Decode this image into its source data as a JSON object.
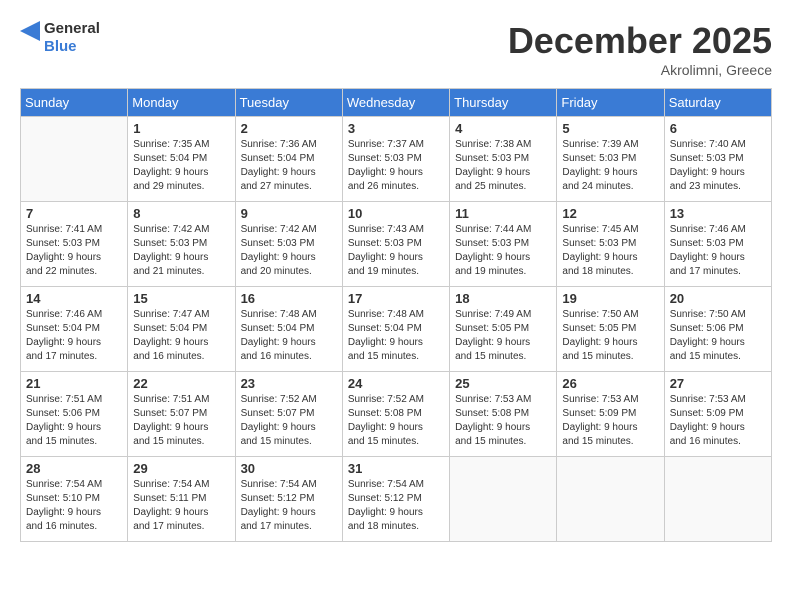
{
  "header": {
    "logo_general": "General",
    "logo_blue": "Blue",
    "month_title": "December 2025",
    "location": "Akrolimni, Greece"
  },
  "weekdays": [
    "Sunday",
    "Monday",
    "Tuesday",
    "Wednesday",
    "Thursday",
    "Friday",
    "Saturday"
  ],
  "weeks": [
    [
      {
        "day": "",
        "info": ""
      },
      {
        "day": "1",
        "info": "Sunrise: 7:35 AM\nSunset: 5:04 PM\nDaylight: 9 hours\nand 29 minutes."
      },
      {
        "day": "2",
        "info": "Sunrise: 7:36 AM\nSunset: 5:04 PM\nDaylight: 9 hours\nand 27 minutes."
      },
      {
        "day": "3",
        "info": "Sunrise: 7:37 AM\nSunset: 5:03 PM\nDaylight: 9 hours\nand 26 minutes."
      },
      {
        "day": "4",
        "info": "Sunrise: 7:38 AM\nSunset: 5:03 PM\nDaylight: 9 hours\nand 25 minutes."
      },
      {
        "day": "5",
        "info": "Sunrise: 7:39 AM\nSunset: 5:03 PM\nDaylight: 9 hours\nand 24 minutes."
      },
      {
        "day": "6",
        "info": "Sunrise: 7:40 AM\nSunset: 5:03 PM\nDaylight: 9 hours\nand 23 minutes."
      }
    ],
    [
      {
        "day": "7",
        "info": "Sunrise: 7:41 AM\nSunset: 5:03 PM\nDaylight: 9 hours\nand 22 minutes."
      },
      {
        "day": "8",
        "info": "Sunrise: 7:42 AM\nSunset: 5:03 PM\nDaylight: 9 hours\nand 21 minutes."
      },
      {
        "day": "9",
        "info": "Sunrise: 7:42 AM\nSunset: 5:03 PM\nDaylight: 9 hours\nand 20 minutes."
      },
      {
        "day": "10",
        "info": "Sunrise: 7:43 AM\nSunset: 5:03 PM\nDaylight: 9 hours\nand 19 minutes."
      },
      {
        "day": "11",
        "info": "Sunrise: 7:44 AM\nSunset: 5:03 PM\nDaylight: 9 hours\nand 19 minutes."
      },
      {
        "day": "12",
        "info": "Sunrise: 7:45 AM\nSunset: 5:03 PM\nDaylight: 9 hours\nand 18 minutes."
      },
      {
        "day": "13",
        "info": "Sunrise: 7:46 AM\nSunset: 5:03 PM\nDaylight: 9 hours\nand 17 minutes."
      }
    ],
    [
      {
        "day": "14",
        "info": "Sunrise: 7:46 AM\nSunset: 5:04 PM\nDaylight: 9 hours\nand 17 minutes."
      },
      {
        "day": "15",
        "info": "Sunrise: 7:47 AM\nSunset: 5:04 PM\nDaylight: 9 hours\nand 16 minutes."
      },
      {
        "day": "16",
        "info": "Sunrise: 7:48 AM\nSunset: 5:04 PM\nDaylight: 9 hours\nand 16 minutes."
      },
      {
        "day": "17",
        "info": "Sunrise: 7:48 AM\nSunset: 5:04 PM\nDaylight: 9 hours\nand 15 minutes."
      },
      {
        "day": "18",
        "info": "Sunrise: 7:49 AM\nSunset: 5:05 PM\nDaylight: 9 hours\nand 15 minutes."
      },
      {
        "day": "19",
        "info": "Sunrise: 7:50 AM\nSunset: 5:05 PM\nDaylight: 9 hours\nand 15 minutes."
      },
      {
        "day": "20",
        "info": "Sunrise: 7:50 AM\nSunset: 5:06 PM\nDaylight: 9 hours\nand 15 minutes."
      }
    ],
    [
      {
        "day": "21",
        "info": "Sunrise: 7:51 AM\nSunset: 5:06 PM\nDaylight: 9 hours\nand 15 minutes."
      },
      {
        "day": "22",
        "info": "Sunrise: 7:51 AM\nSunset: 5:07 PM\nDaylight: 9 hours\nand 15 minutes."
      },
      {
        "day": "23",
        "info": "Sunrise: 7:52 AM\nSunset: 5:07 PM\nDaylight: 9 hours\nand 15 minutes."
      },
      {
        "day": "24",
        "info": "Sunrise: 7:52 AM\nSunset: 5:08 PM\nDaylight: 9 hours\nand 15 minutes."
      },
      {
        "day": "25",
        "info": "Sunrise: 7:53 AM\nSunset: 5:08 PM\nDaylight: 9 hours\nand 15 minutes."
      },
      {
        "day": "26",
        "info": "Sunrise: 7:53 AM\nSunset: 5:09 PM\nDaylight: 9 hours\nand 15 minutes."
      },
      {
        "day": "27",
        "info": "Sunrise: 7:53 AM\nSunset: 5:09 PM\nDaylight: 9 hours\nand 16 minutes."
      }
    ],
    [
      {
        "day": "28",
        "info": "Sunrise: 7:54 AM\nSunset: 5:10 PM\nDaylight: 9 hours\nand 16 minutes."
      },
      {
        "day": "29",
        "info": "Sunrise: 7:54 AM\nSunset: 5:11 PM\nDaylight: 9 hours\nand 17 minutes."
      },
      {
        "day": "30",
        "info": "Sunrise: 7:54 AM\nSunset: 5:12 PM\nDaylight: 9 hours\nand 17 minutes."
      },
      {
        "day": "31",
        "info": "Sunrise: 7:54 AM\nSunset: 5:12 PM\nDaylight: 9 hours\nand 18 minutes."
      },
      {
        "day": "",
        "info": ""
      },
      {
        "day": "",
        "info": ""
      },
      {
        "day": "",
        "info": ""
      }
    ]
  ]
}
